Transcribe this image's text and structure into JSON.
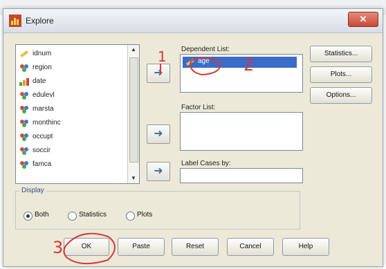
{
  "window": {
    "title": "Explore",
    "close_glyph": "✕"
  },
  "variables": [
    {
      "label": "idnum",
      "icon": "ruler-icon"
    },
    {
      "label": "region",
      "icon": "nominal-icon"
    },
    {
      "label": "date",
      "icon": "ordinal-icon"
    },
    {
      "label": "edulevl",
      "icon": "nominal-icon"
    },
    {
      "label": "marsta",
      "icon": "nominal-icon"
    },
    {
      "label": "monthinc",
      "icon": "nominal-icon"
    },
    {
      "label": "occupt",
      "icon": "nominal-icon"
    },
    {
      "label": "soccir",
      "icon": "nominal-icon"
    },
    {
      "label": "famca",
      "icon": "nominal-icon"
    }
  ],
  "dependent": {
    "label": "Dependent List:",
    "items": [
      "age"
    ]
  },
  "factor": {
    "label": "Factor List:"
  },
  "label_cases": {
    "label": "Label Cases by:"
  },
  "side_buttons": [
    "Statistics...",
    "Plots...",
    "Options..."
  ],
  "display": {
    "label": "Display",
    "options": [
      {
        "label": "Both",
        "selected": true
      },
      {
        "label": "Statistics",
        "selected": false
      },
      {
        "label": "Plots",
        "selected": false
      }
    ]
  },
  "bottom_buttons": [
    "OK",
    "Paste",
    "Reset",
    "Cancel",
    "Help"
  ],
  "annotations": {
    "one": "1",
    "two": "2",
    "three": "3"
  },
  "colors": {
    "annotation": "#d23a33",
    "selection": "#3b6cc8"
  }
}
